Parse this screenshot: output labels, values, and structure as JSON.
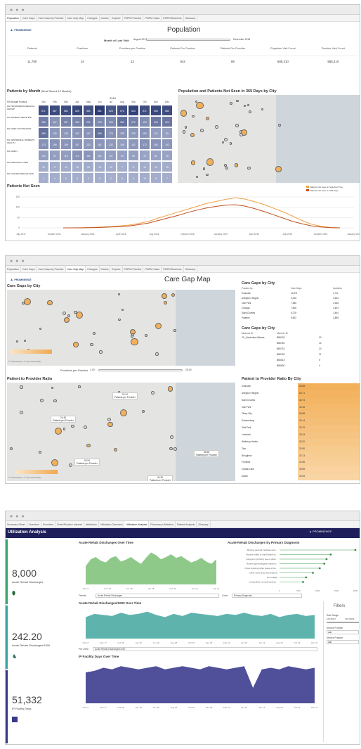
{
  "win1": {
    "dots": "● ● ●",
    "tabs": [
      "Population",
      "Care Gaps",
      "Care Gaps by Practice",
      "Care Gap Map",
      "Changes",
      "Claims",
      "Explore",
      "PMPM Practice",
      "PMPM Class",
      "PMPM Business",
      "Glossary"
    ],
    "brand": "PROMINENCE",
    "title": "Population",
    "filter_label": "Month of Last Visit",
    "filter_start": "August 2017",
    "filter_end": "December 2018",
    "kpi_headers": [
      "Patients",
      "Practices",
      "Providers per Practice",
      "Patients Per Practice",
      "Patients Per Provider",
      "Physician Visit Count",
      "Practice Visit Count"
    ],
    "kpi_values": [
      "11,780",
      "14",
      "12",
      "842",
      "69",
      "585,210",
      "585,210"
    ],
    "matrix_title": "Patients by Month",
    "matrix_subtitle": "(Most Recent 12 Months)",
    "matrix_year": "2018",
    "matrix_rowhead": "KW Budget Practice",
    "matrix_months": [
      "Jan",
      "Feb",
      "Mar",
      "Apr",
      "May",
      "Jun",
      "Jul",
      "Aug",
      "Sep",
      "Oct",
      "Nov",
      "Dec"
    ],
    "matrix_rows": [
      {
        "label": "PH PROMINENCE MEDICAL GROUP",
        "values": [
          "571",
          "587",
          "582",
          "625",
          "551",
          "681",
          "520",
          "572",
          "644",
          "571",
          "606",
          "583"
        ]
      },
      {
        "label": "PH GENERAL MEDICINE",
        "values": [
          "286",
          "167",
          "257",
          "250",
          "291",
          "219",
          "220",
          "362",
          "272",
          "194",
          "318",
          "324"
        ]
      },
      {
        "label": "PH FAMILY PHYSICIANS",
        "values": [
          "365",
          "135",
          "136",
          "162",
          "167",
          "365",
          "178",
          "155",
          "135",
          "159",
          "107",
          "90"
        ]
      },
      {
        "label": "PH CENTENNIAL WOMEN'S HEALTH",
        "values": [
          "173",
          "166",
          "159",
          "167",
          "132",
          "151",
          "132",
          "105",
          "142",
          "172",
          "160",
          "142"
        ]
      },
      {
        "label": "PH FAMILY",
        "values": [
          "104",
          "97",
          "115",
          "171",
          "151",
          "101",
          "107",
          "94",
          "90",
          "70",
          "82",
          "76"
        ]
      },
      {
        "label": "PH PEDIATRIC CARE",
        "values": [
          "16",
          "17",
          "19",
          "16",
          "20",
          "16",
          "12",
          "7",
          "17",
          "14",
          "14",
          "15"
        ]
      },
      {
        "label": "PH CANCER SPECIALISTS",
        "values": [
          "1",
          "4",
          "6",
          "6",
          "2",
          "5",
          "2",
          "4",
          "6",
          "10",
          "6",
          "7"
        ]
      }
    ],
    "map_title": "Population and Patients Not Seen in 365 Days by City",
    "map_credit": "© 2019 Mapbox © OpenStreetMap",
    "line_title": "Patients Not Seen",
    "legend": [
      "Patients Not Seen in Selected Time",
      "Patients Not Seen in 365 Days"
    ],
    "y_ticks": [
      "150",
      "100",
      "50",
      "0"
    ],
    "x_ticks": [
      "July 2017",
      "October 2017",
      "January 2018",
      "April 2018",
      "July 2018",
      "October 2018",
      "January 2019",
      "April 2019",
      "July 2019",
      "October 2019",
      "January 2020"
    ]
  },
  "win2": {
    "dots": "● ● ●",
    "tabs": [
      "Population",
      "Care Gaps",
      "Care Gaps by Practice",
      "Care Gap Map",
      "Changes",
      "Claims",
      "Explore",
      "PMPM Practice",
      "PMPM Class",
      "PMPM Business",
      "Glossary"
    ],
    "brand": "PROMINENCE",
    "title": "Care Gap Map",
    "map1_title": "Care Gaps by City",
    "map_credit": "© 2019 Mapbox © OpenStreetMap",
    "slider_label": "Providers per Practice",
    "slider_min": "1.00",
    "slider_max": "20.00",
    "table1_title": "Care Gaps by City",
    "table1_headers": [
      "Practice by",
      "Care Gaps",
      "Incidents"
    ],
    "table1_rows": [
      [
        "Evanston",
        "11,871",
        "1,711"
      ],
      [
        "Arlington Heights",
        "9,418",
        "1,644"
      ],
      [
        "Oak Park",
        "7,388",
        "1,548"
      ],
      [
        "Chicago",
        "7,608",
        "1,493"
      ],
      [
        "Saint Charles",
        "6,278",
        "1,464"
      ],
      [
        "Palatine",
        "5,962",
        "2,898"
      ]
    ],
    "table2_title": "Care Gaps by City",
    "table2_headers": [
      "Measure ID",
      "Member ID"
    ],
    "table2_left": "CF_Alcoholism Misuse...",
    "table2_rows": [
      [
        "BB0000",
        "20"
      ],
      [
        "BB0760",
        "14"
      ],
      [
        "BB0751",
        "20"
      ],
      [
        "BB0756",
        "11"
      ],
      [
        "BB0615",
        "5"
      ],
      [
        "BB0800",
        "4"
      ]
    ],
    "map2_title": "Patient to Provider Ratio",
    "map2_labels": [
      "23.24",
      "Patients per Provider",
      "24.48",
      "Patients per Provider",
      "33.94",
      "Patients per Provider",
      "53.68",
      "Patients per Provider",
      "40.36",
      "Patients per Provider"
    ],
    "ratio_title": "Patient to Provider Ratio By City",
    "ratio_rows": [
      [
        "Evanston",
        "53.68"
      ],
      [
        "Arlington Heights",
        "53.71"
      ],
      [
        "Saint Charles",
        "46.74"
      ],
      [
        "Oak Park",
        "42.26"
      ],
      [
        "Olney City",
        "39.68"
      ],
      [
        "Schaumburg",
        "34.14"
      ],
      [
        "Villa Park",
        "33.79"
      ],
      [
        "Lombard",
        "33.43"
      ],
      [
        "Winthrop Harbor",
        "33.20"
      ],
      [
        "Zion",
        "32.90"
      ],
      [
        "Broughton",
        "32.13"
      ],
      [
        "Frontline",
        "31.56"
      ],
      [
        "Crystal Lake",
        "30.85"
      ],
      [
        "Dalton",
        "30.35"
      ]
    ]
  },
  "win3": {
    "dots": "● ● ●",
    "tabs": [
      "Summary Sheet",
      "Overview",
      "Providers",
      "Chart/Practice Interest",
      "Attribution",
      "Utilization Overview",
      "Utilization Analysis",
      "Pharmacy Utilization",
      "Patient Analysis",
      "Glossary"
    ],
    "page_title": "Utilization Analysis",
    "brand": "PROMINENCE",
    "brand_sub": "Healthcare Group",
    "kpi1_value": "8,000",
    "kpi1_label": "Acute Rehab Discharges",
    "kpi2_value": "242.20",
    "kpi2_label": "Acute Rehab Discharges/1000",
    "kpi3_value": "51,332",
    "kpi3_label": "IP Facility Days",
    "chart1_title": "Acute Rehab Discharges Over Time",
    "chart2_title": "Acute Rehab Discharges by Primary Diagnosis",
    "diag_labels": [
      "Routine general medical exam...",
      "Routine infant or child health ch...",
      "Long term (current) use of other...",
      "Routine gynecological examina...",
      "Crisis involving other plans of the...",
      "Other screening examinations",
      "Fix multiple",
      "Unspecified musculoskeletal..."
    ],
    "diag_values": [
      2000,
      1350,
      1240,
      1180,
      1060,
      880,
      700,
      620
    ],
    "diag_axis": [
      "0",
      "500",
      "1000",
      "1500",
      "2000"
    ],
    "trend_label": "Trends",
    "trend_value": "Acute Rehab Discharges",
    "color_label": "Color",
    "color_value": "Primary Diagnosis",
    "chart3_title": "Acute Rehab Discharges/1000 Over Time",
    "per_label": "Per 1000",
    "per_value": "Acute Rehab Discharges/1000",
    "chart4_title": "IP Facility Days Over Time",
    "x_ticks": [
      "Oct 17",
      "Feb 18",
      "Jun 18",
      "Oct 18",
      "Feb 19",
      "Jun 19",
      "Oct 19"
    ],
    "x_ticks_b": [
      "Oct 17",
      "Dec 17",
      "Feb 18",
      "Apr 18",
      "Jun 18",
      "Aug 18",
      "Oct 18",
      "Dec 18",
      "Feb 19",
      "Apr 19",
      "Jun 19",
      "Aug 19",
      "Oct 19",
      "Dec 19"
    ],
    "filters_title": "Filters",
    "f_date_label": "Date Range",
    "f_date_start": "10/1/2017",
    "f_date_end": "12/1/2019",
    "f_provider_label": "Service Provider",
    "f_provider_value": "(All)",
    "f_practice_label": "Service Practice",
    "f_practice_value": "(All)"
  }
}
